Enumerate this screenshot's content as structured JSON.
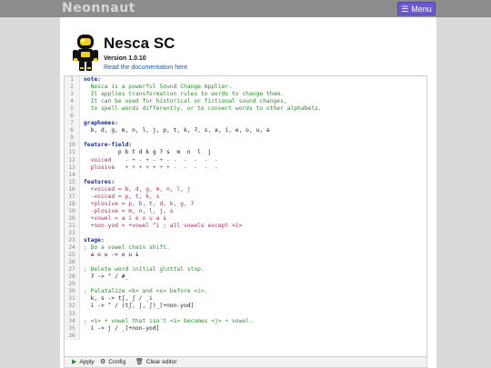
{
  "header": {
    "brand": "Neonnaut",
    "menu_label": "Menu",
    "menu_icon": "hamburger-icon"
  },
  "app": {
    "title": "Nesca SC",
    "version": "Version 1.0.10",
    "doc_link": "Read the documentation here",
    "logo_icon": "astronaut-icon"
  },
  "editor": {
    "lines": [
      {
        "n": "1",
        "t": "note:"
      },
      {
        "n": "2",
        "t": "  Nesca is a powerful Sound Change Applier."
      },
      {
        "n": "3",
        "t": "  It applies transformation rules to words to change them."
      },
      {
        "n": "4",
        "t": "  It can be used for historical or fictional sound changes,"
      },
      {
        "n": "5",
        "t": "  to spell words differently, or to convert words to other alphabets."
      },
      {
        "n": "6",
        "t": ""
      },
      {
        "n": "7",
        "t": "graphemes:"
      },
      {
        "n": "8",
        "t": "  b, d, g, m, n, l, j, p, t, k, ʔ, s, a, i, e, o, u, ə"
      },
      {
        "n": "9",
        "t": ""
      },
      {
        "n": "10",
        "t": "feature-field:"
      },
      {
        "n": "11",
        "t": "          p b t d k g ʔ s  m  n  l  j"
      },
      {
        "n": "12",
        "t": "  voiced    - + - + - + - -  -  -  -  -"
      },
      {
        "n": "13",
        "t": "  plosive   + + + + + + + -  -  -  -  -"
      },
      {
        "n": "14",
        "t": ""
      },
      {
        "n": "15",
        "t": "features:"
      },
      {
        "n": "16",
        "t": "  +voiced = b, d, g, m, n, l, j"
      },
      {
        "n": "17",
        "t": "  -voiced = p, t, k, s"
      },
      {
        "n": "18",
        "t": "  +plosive = p, b, t, d, k, g, ʔ"
      },
      {
        "n": "19",
        "t": "  -plosive = m, n, l, j, s"
      },
      {
        "n": "20",
        "t": "  +vowel = a i e o u ə ɨ"
      },
      {
        "n": "21",
        "t": "  +non-yod = +vowel ^i ; all vowels except <i>"
      },
      {
        "n": "22",
        "t": ""
      },
      {
        "n": "23",
        "t": "stage:"
      },
      {
        "n": "24",
        "t": "; Do a vowel chain shift."
      },
      {
        "n": "25",
        "t": "  ə o u -> o u ɨ"
      },
      {
        "n": "26",
        "t": ""
      },
      {
        "n": "27",
        "t": "; Delete word initial glottal stop."
      },
      {
        "n": "28",
        "t": "  ʔ -> ^ / #_"
      },
      {
        "n": "29",
        "t": ""
      },
      {
        "n": "30",
        "t": "; Palatalize <k> and <s> before <i>."
      },
      {
        "n": "31",
        "t": "  k, s -> tʃ, ʃ / _i"
      },
      {
        "n": "32",
        "t": "  i -> ^ / (tʃ, j, ʃ)_[+non-yod]"
      },
      {
        "n": "33",
        "t": ""
      },
      {
        "n": "34",
        "t": "; <i> + vowel that isn't <i> becomes <j> + vowel."
      },
      {
        "n": "35",
        "t": "  i -> j / _[+non-yod]"
      },
      {
        "n": "36",
        "t": ""
      }
    ]
  },
  "toolbar": {
    "apply_label": "Apply",
    "apply_icon": "play-icon",
    "config_label": "Config",
    "config_icon": "gear-icon",
    "clear_label": "Clear editor",
    "clear_icon": "trash-icon"
  }
}
